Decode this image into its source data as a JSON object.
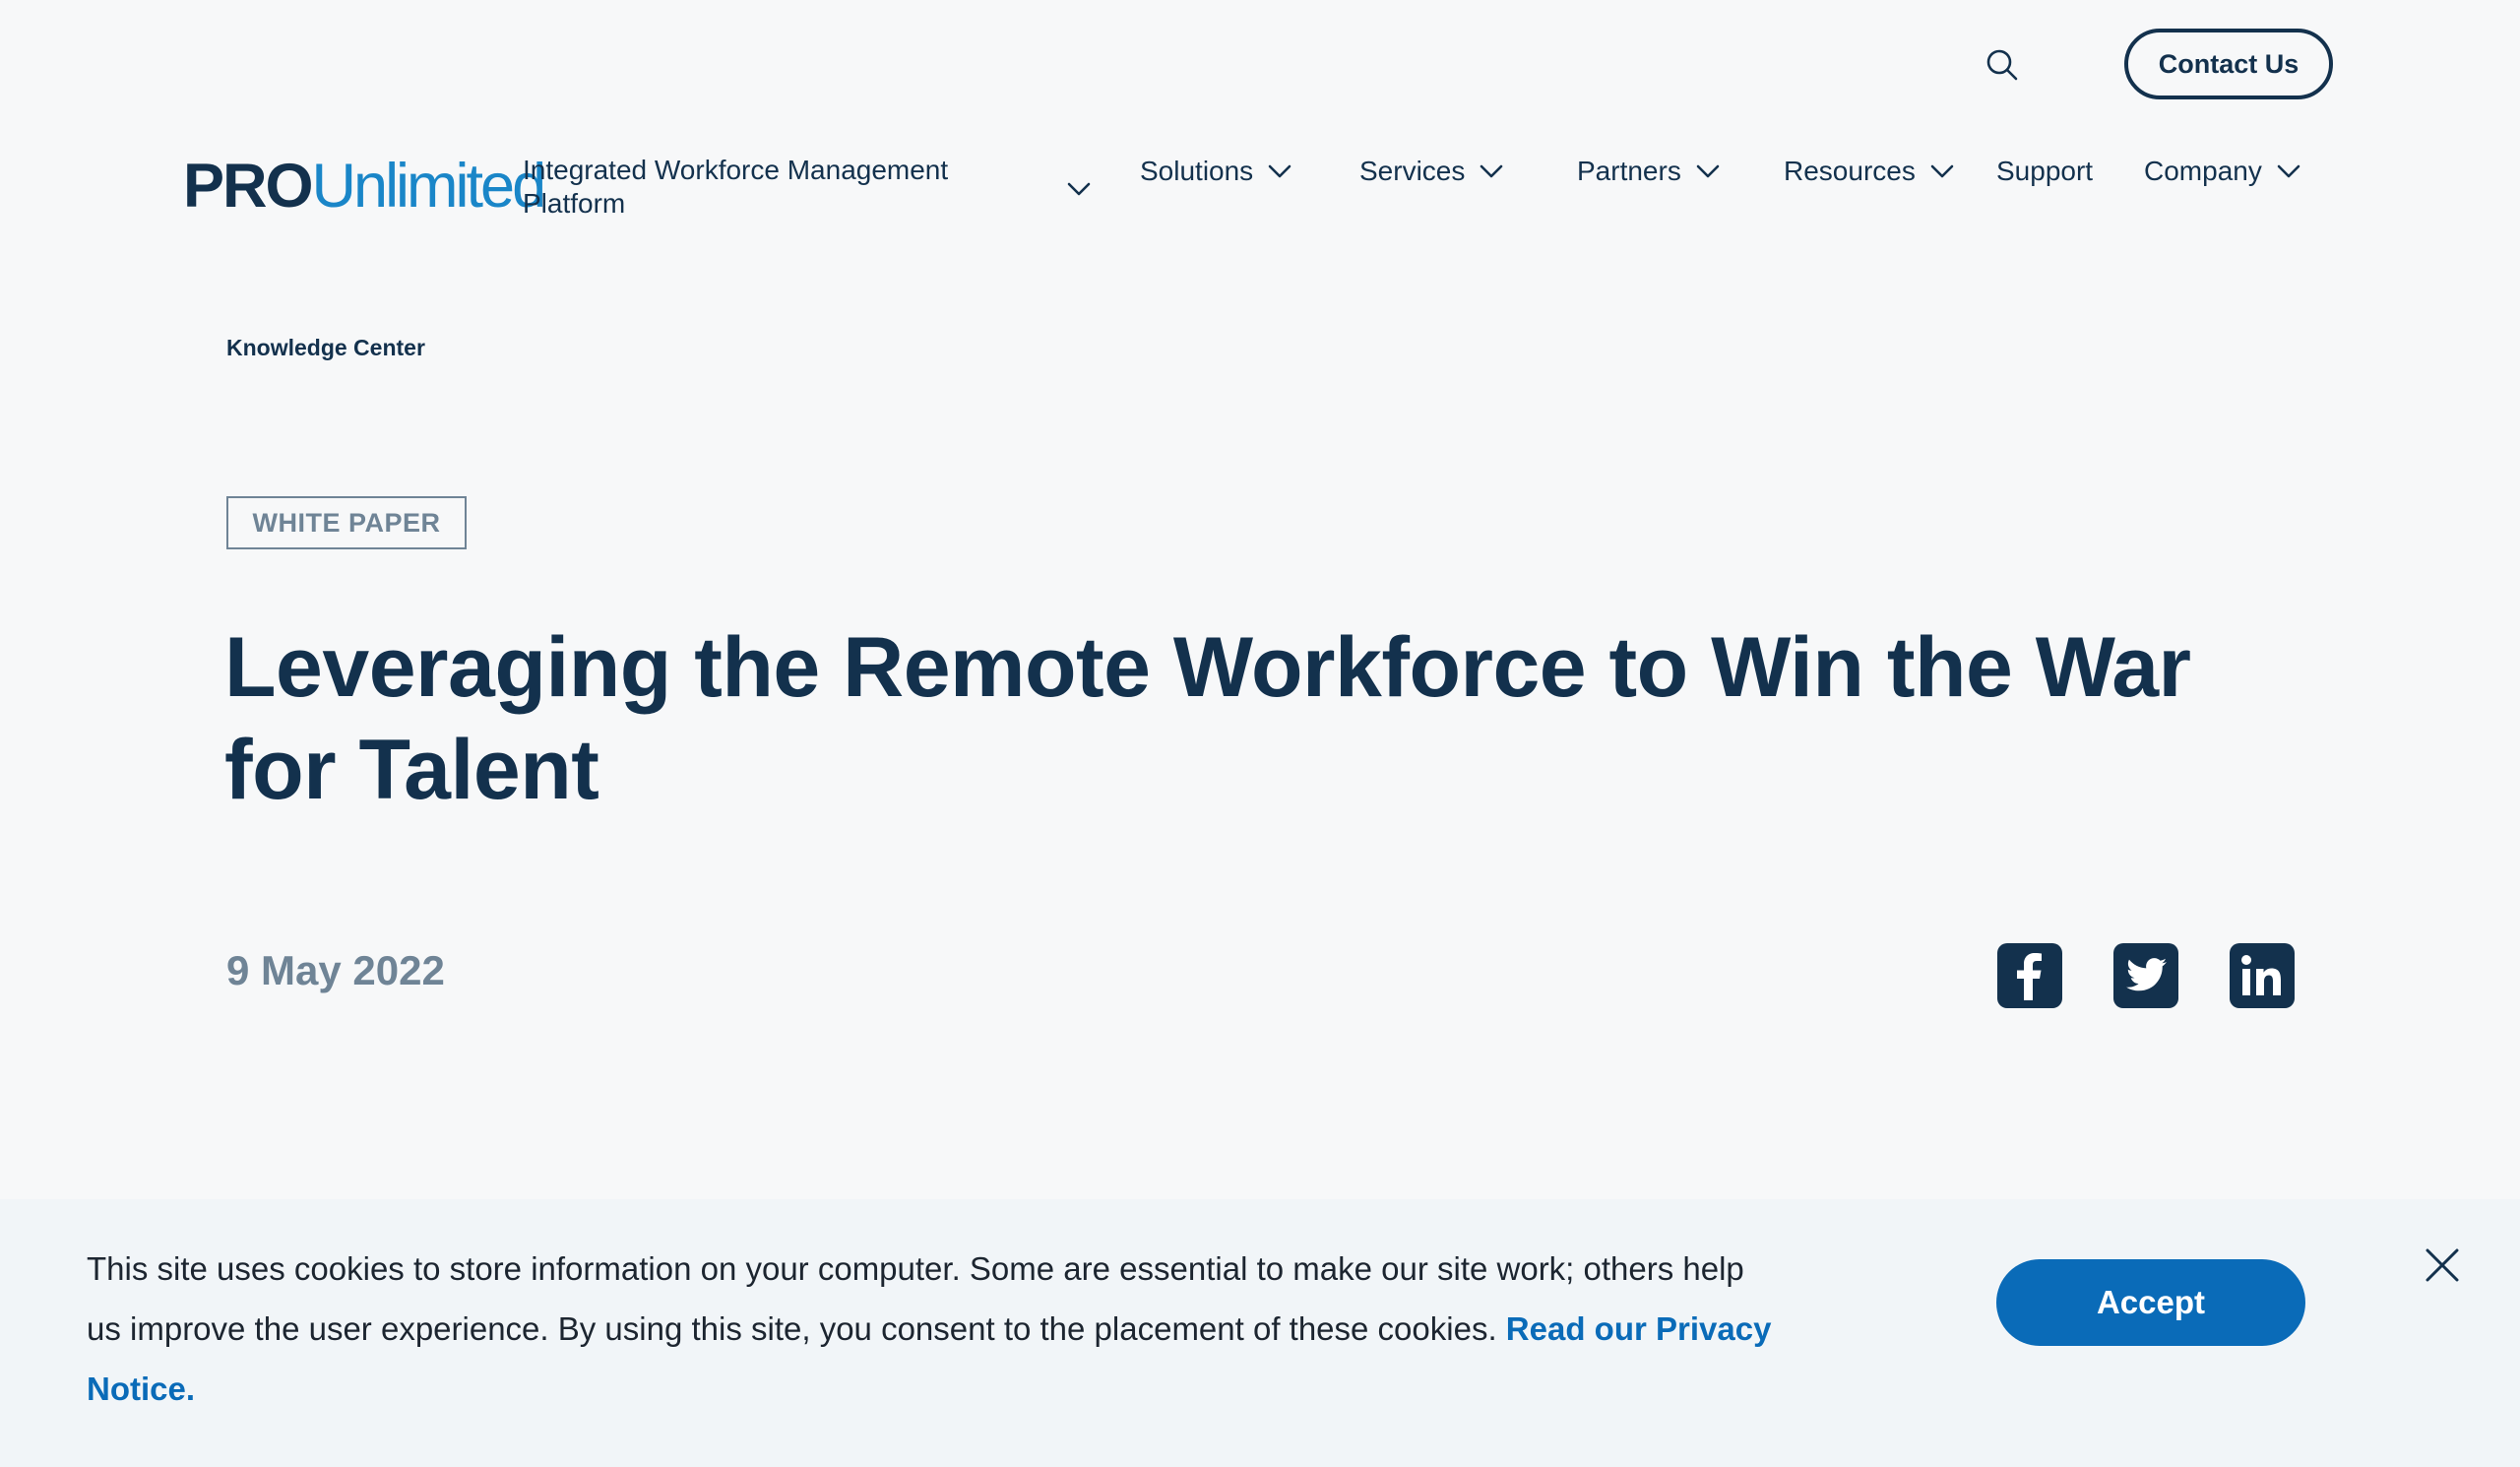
{
  "header": {
    "contact_label": "Contact Us",
    "logo": {
      "pro": "PRO",
      "unlimited": "Unlimited"
    },
    "platform_label": "Integrated Workforce Management Platform",
    "nav": [
      {
        "label": "Solutions"
      },
      {
        "label": "Services"
      },
      {
        "label": "Partners"
      },
      {
        "label": "Resources"
      },
      {
        "label": "Support"
      },
      {
        "label": "Company"
      }
    ]
  },
  "article": {
    "breadcrumb": "Knowledge Center",
    "tag": "WHITE PAPER",
    "title": "Leveraging the Remote Workforce to Win the War for Talent",
    "date": "9 May 2022",
    "share": [
      "facebook-icon",
      "twitter-icon",
      "linkedin-icon"
    ]
  },
  "cookie_banner": {
    "text": "This site uses cookies to store information on your computer. Some are essential to make our site work; others help us improve the user experience. By using this site, you consent to the placement of these cookies.",
    "link_label": "Read our Privacy Notice.",
    "accept_label": "Accept"
  },
  "colors": {
    "navy": "#13314d",
    "brand_blue": "#1a86c8",
    "accept_blue": "#0a6bb8",
    "muted": "#6f8496",
    "background": "#f7f8f9",
    "banner_background": "#f1f5f8"
  }
}
